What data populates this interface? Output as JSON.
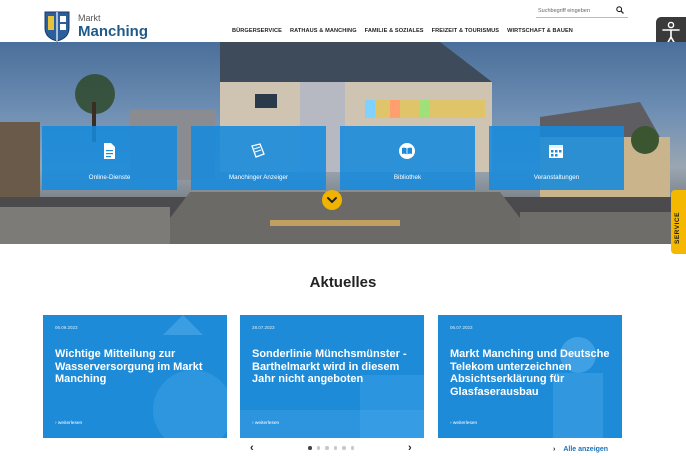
{
  "header": {
    "logo_small": "Markt",
    "logo_big": "Manching",
    "search_placeholder": "Suchbegriff eingeben",
    "nav": [
      "BÜRGERSERVICE",
      "RATHAUS & MANCHING",
      "FAMILIE & SOZIALES",
      "FREIZEIT & TOURISMUS",
      "WIRTSCHAFT & BAUEN"
    ]
  },
  "hero": {
    "tiles": [
      {
        "label": "Online-Dienste",
        "icon": "document-icon"
      },
      {
        "label": "Manchinger Anzeiger",
        "icon": "newspaper-icon"
      },
      {
        "label": "Bibliothek",
        "icon": "book-icon"
      },
      {
        "label": "Veranstaltungen",
        "icon": "calendar-icon"
      }
    ],
    "service_tab": "SERVICE"
  },
  "news": {
    "title": "Aktuelles",
    "cards": [
      {
        "date": "06.09.2023",
        "headline": "Wichtige Mitteilung zur Wasserversorgung im Markt Manching",
        "more": "› weiterlesen"
      },
      {
        "date": "28.07.2023",
        "headline": "Sonderlinie Münchsmünster - Barthelmarkt wird in diesem Jahr nicht angeboten",
        "more": "› weiterlesen"
      },
      {
        "date": "06.07.2023",
        "headline": "Markt Manching und Deutsche Telekom unterzeichnen Absichtserklärung für Glasfaserausbau",
        "more": "› weiterlesen"
      }
    ],
    "pager_prev": "‹",
    "pager_next": "›",
    "all_chevron": "›",
    "all_link": "Alle anzeigen"
  },
  "colors": {
    "accent_blue": "#1e8bd8",
    "accent_yellow": "#f0b400",
    "brand_blue": "#1e5a8a"
  }
}
